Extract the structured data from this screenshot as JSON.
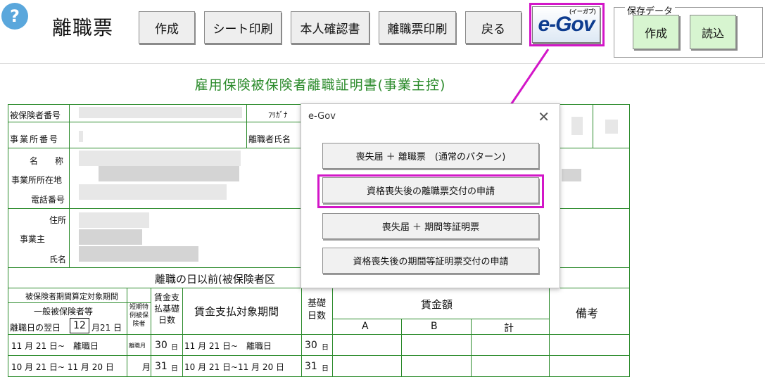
{
  "toolbar": {
    "help_glyph": "?",
    "title": "離職票",
    "buttons": [
      "作成",
      "シート印刷",
      "本人確認書",
      "離職票印刷",
      "戻る"
    ],
    "egov_logo": "e-Gov",
    "egov_sub": "(イーガブ)",
    "save_data_label": "保存データ",
    "save_buttons": [
      "作成",
      "読込"
    ]
  },
  "document": {
    "title": "雇用保険被保険者離職証明書(事業主控)",
    "labels": {
      "insured_number": "被保険者番号",
      "office_number": "事業所番号",
      "furigana": "ﾌﾘｶﾞﾅ",
      "separated_name": "離職者氏名",
      "name": "名　　称",
      "office_address": "事業所所在地",
      "phone": "電話番号",
      "address": "住所",
      "employer": "事業主",
      "owner_name": "氏名",
      "section_header": "離職の日以前(被保険者区",
      "period_header": "被保険者期間算定対象期間",
      "general_insured": "一般被保険者等",
      "short_term": "短期特例被保険者",
      "day_after": "離職日の翌日",
      "wage_days": "賃金支払基礎日数",
      "wage_period": "賃金支払対象期間",
      "basic_days": "基礎日数",
      "wage_amount": "賃金額",
      "col_a": "A",
      "col_b": "B",
      "col_total": "計",
      "remarks": "備考"
    },
    "separation_month": "12",
    "separation_rest": "月21 日",
    "rows": [
      {
        "period": "11 月 21 日~　離職日",
        "short": "離職月",
        "days": "30",
        "day_unit": "日",
        "wage_period": "11 月 21 日~　離職日",
        "basic": "30",
        "basic_unit": "日"
      },
      {
        "period": "10 月 21 日~ 11 月 20 日",
        "short": "月",
        "days": "31",
        "day_unit": "日",
        "wage_period": "10 月 21 日~11 月 20 日",
        "basic": "31",
        "basic_unit": "日"
      }
    ]
  },
  "dialog": {
    "title": "e-Gov",
    "close_glyph": "✕",
    "options": [
      "喪失届 ＋ 離職票　(通常のパターン)",
      "資格喪失後の離職票交付の申請",
      "喪失届 ＋ 期間等証明票",
      "資格喪失後の期間等証明票交付の申請"
    ],
    "highlighted_index": 1
  },
  "colors": {
    "annotation": "#d316c8",
    "form_green": "#2a8a2a",
    "save_button": "#d7f5d0",
    "help_icon": "#5aa7dc"
  }
}
